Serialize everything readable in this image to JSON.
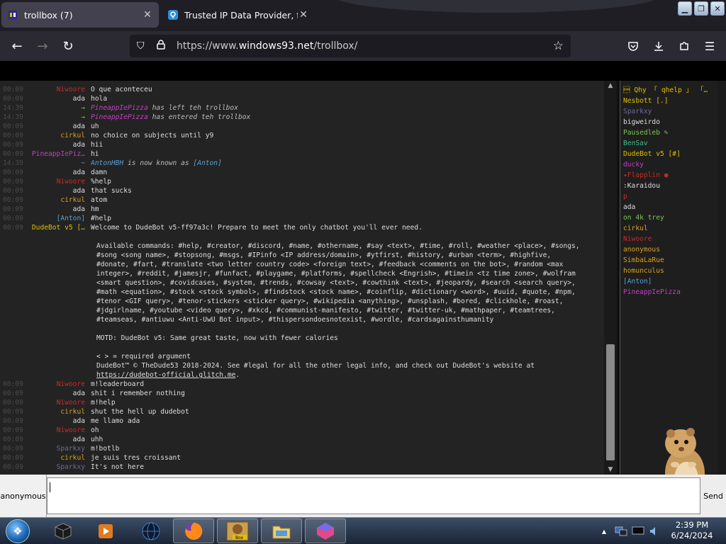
{
  "browser": {
    "tabs": [
      {
        "title": "trollbox (7)",
        "favicon": "trollbox-icon"
      },
      {
        "title": "Trusted IP Data Provider, from",
        "favicon": "ipinfo-icon"
      }
    ],
    "url_prefix": "https://www.",
    "url_domain": "windows93.net",
    "url_path": "/trollbox/"
  },
  "chat": {
    "messages": [
      {
        "time": "00:09",
        "nick": "Niwoore",
        "color": "#c82a2a",
        "text": "O que aconteceu"
      },
      {
        "time": "00:09",
        "nick": "ada",
        "color": "#dddddd",
        "text": "hola"
      },
      {
        "time": "14:39",
        "nick": "→",
        "color": "#7ac74f",
        "system": true,
        "actor": "PineappIePizza",
        "actor_color": "#c040c0",
        "text": " has left teh trollbox"
      },
      {
        "time": "14:39",
        "nick": "→",
        "color": "#7ac74f",
        "system": true,
        "actor": "PineappIePizza",
        "actor_color": "#c040c0",
        "text": " has entered teh trollbox"
      },
      {
        "time": "00:09",
        "nick": "ada",
        "color": "#dddddd",
        "text": "uh"
      },
      {
        "time": "00:09",
        "nick": "cirkul",
        "color": "#d9a020",
        "text": "no choice on subjects until y9"
      },
      {
        "time": "00:09",
        "nick": "ada",
        "color": "#dddddd",
        "text": "hii"
      },
      {
        "time": "00:09",
        "nick": "PineappIePiz…",
        "color": "#c040c0",
        "text": "hi"
      },
      {
        "time": "14:39",
        "nick": "~",
        "color": "#5aa0d0",
        "system": true,
        "actor": "AntonHBH",
        "actor_color": "#5aa0d0",
        "text": " is now known as ",
        "target": "[Anton]",
        "target_color": "#5aa0d0"
      },
      {
        "time": "00:09",
        "nick": "ada",
        "color": "#dddddd",
        "text": "damn"
      },
      {
        "time": "00:09",
        "nick": "Niwoore",
        "color": "#c82a2a",
        "text": "%help"
      },
      {
        "time": "00:09",
        "nick": "ada",
        "color": "#dddddd",
        "text": "that sucks"
      },
      {
        "time": "00:09",
        "nick": "cirkul",
        "color": "#d9a020",
        "text": "atom"
      },
      {
        "time": "00:09",
        "nick": "ada",
        "color": "#dddddd",
        "text": "hm"
      },
      {
        "time": "00:09",
        "nick": "[Anton]",
        "color": "#5aa0d0",
        "text": "#help"
      },
      {
        "time": "00:09",
        "nick": "DudeBot v5 […",
        "color": "#e0c000",
        "text": "Welcome to DudeBot v5-ff97a3c! Prepare to meet the only chatbot you'll ever need."
      }
    ],
    "bot_block": [
      "",
      "Available commands: #help, #creator, #discord, #name, #othername, #say <text>, #time, #roll, #weather <place>, #songs,",
      "#song <song name>, #stopsong, #msgs, #IPinfo <IP address/domain>, #ytfirst, #history, #urban <term>, #highfive,",
      "#donate, #fart, #translate <two letter country code> <foreign text>, #feedback <comments on the bot>, #random <max",
      "integer>, #reddit, #jamesjr, #funfact, #playgame, #platforms, #spellcheck <Engrish>, #timein <tz time zone>, #wolfram",
      "<smart question>, #covidcases, #system, #trends, #cowsay <text>, #cowthink <text>, #jeopardy, #search <search query>,",
      "#math <equation>, #stock <stock symbol>, #findstock <stock name>, #coinflip, #dictionary <word>, #uuid, #quote, #npm,",
      "#tenor <GIF query>, #tenor-stickers <sticker query>, #wikipedia <anything>, #unsplash, #bored, #clickhole, #roast,",
      "#jdgirlname, #youtube <video query>, #xkcd, #communist-manifesto, #twitter, #twitter-uk, #mathpaper, #teamtrees,",
      "#teamseas, #antiuwu <Anti-UwU Bot input>, #thispersondoesnotexist, #wordle, #cardsagainsthumanity",
      "",
      "MOTD: DudeBot v5: Same great taste, now with fewer calories",
      "",
      "< > = required argument",
      "DudeBot™ © TheDude53 2018-2024. See #legal for all the other legal info, and check out DudeBot's website at"
    ],
    "bot_link": "https://dudebot-official.glitch.me",
    "bot_link_tail": ".",
    "messages_after": [
      {
        "time": "00:09",
        "nick": "Niwoore",
        "color": "#c82a2a",
        "text": "m!leaderboard"
      },
      {
        "time": "00:09",
        "nick": "ada",
        "color": "#dddddd",
        "text": "shit i remember nothing"
      },
      {
        "time": "00:09",
        "nick": "Niwoore",
        "color": "#c82a2a",
        "text": "m!help"
      },
      {
        "time": "00:09",
        "nick": "cirkul",
        "color": "#d9a020",
        "text": "shut the hell up dudebot"
      },
      {
        "time": "00:09",
        "nick": "ada",
        "color": "#dddddd",
        "text": "me llamo ada"
      },
      {
        "time": "00:09",
        "nick": "Niwoore",
        "color": "#c82a2a",
        "text": "oh"
      },
      {
        "time": "00:09",
        "nick": "ada",
        "color": "#dddddd",
        "text": "uhh"
      },
      {
        "time": "00:09",
        "nick": "Sparkxy",
        "color": "#6c6c9a",
        "text": "m!botlb"
      },
      {
        "time": "00:09",
        "nick": "cirkul",
        "color": "#d9a020",
        "text": "je suis tres croissant"
      },
      {
        "time": "00:09",
        "nick": "Sparkxy",
        "color": "#6c6c9a",
        "text": "It's not here"
      }
    ]
  },
  "users": [
    {
      "name": "\u0001 Qhy 「 qhelp 」 「…",
      "color": "#e0c000"
    },
    {
      "name": "Nesbott [.]",
      "color": "#e0c000"
    },
    {
      "name": "Sparkxy",
      "color": "#6c6c9a"
    },
    {
      "name": "bigweirdo",
      "color": "#dddddd"
    },
    {
      "name": "Pausedleb ✎",
      "color": "#7ac74f"
    },
    {
      "name": "BenSav",
      "color": "#3fbf8f"
    },
    {
      "name": "DudeBot v5 [#]",
      "color": "#e0c000"
    },
    {
      "name": "ducky",
      "color": "#c040c0"
    },
    {
      "name": "✦Flapplin ●",
      "color": "#c82a2a"
    },
    {
      "name": ":Karaidou",
      "color": "#dddddd"
    },
    {
      "name": "p",
      "color": "#c82a2a"
    },
    {
      "name": "ada",
      "color": "#dddddd"
    },
    {
      "name": "on 4k trey",
      "color": "#7ac74f"
    },
    {
      "name": "cirkul",
      "color": "#d9a020"
    },
    {
      "name": "Niwoore",
      "color": "#c82a2a"
    },
    {
      "name": "anonymous",
      "color": "#d9a020"
    },
    {
      "name": "SimbaLaRue",
      "color": "#d9a020"
    },
    {
      "name": "homunculus",
      "color": "#d9a020"
    },
    {
      "name": "[Anton]",
      "color": "#5aa0d0"
    },
    {
      "name": "PineappIePizza",
      "color": "#c040c0"
    }
  ],
  "input": {
    "nickname": "anonymous",
    "send_label": "Send"
  },
  "taskbar": {
    "time": "2:39 PM",
    "date": "6/24/2024",
    "box_label": "Box"
  }
}
